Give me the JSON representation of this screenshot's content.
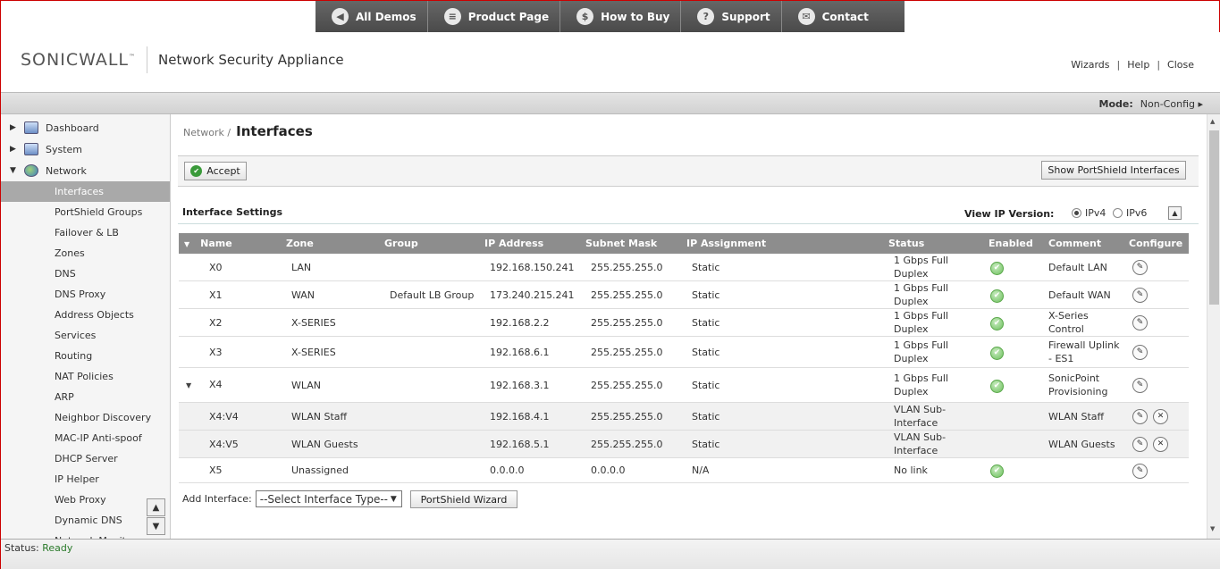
{
  "demo_nav": [
    {
      "label": "All Demos",
      "icon": "back-arrow-icon",
      "glyph": "◀"
    },
    {
      "label": "Product Page",
      "icon": "list-icon",
      "glyph": "≡"
    },
    {
      "label": "How to Buy",
      "icon": "dollar-icon",
      "glyph": "$"
    },
    {
      "label": "Support",
      "icon": "question-icon",
      "glyph": "?"
    },
    {
      "label": "Contact",
      "icon": "mail-icon",
      "glyph": "✉"
    }
  ],
  "header": {
    "logo_text": "SONICWALL",
    "logo_tm": "™",
    "product_title": "Network Security Appliance",
    "links": [
      "Wizards",
      "Help",
      "Close"
    ]
  },
  "modebar": {
    "mode_label": "Mode:",
    "mode_value": "Non-Config ▸"
  },
  "sidebar": {
    "top_items": [
      {
        "label": "Dashboard",
        "icon": "dashboard-icon"
      },
      {
        "label": "System",
        "icon": "monitor-icon"
      },
      {
        "label": "Network",
        "icon": "globe-icon"
      }
    ],
    "network_items": [
      "Interfaces",
      "PortShield Groups",
      "Failover & LB",
      "Zones",
      "DNS",
      "DNS Proxy",
      "Address Objects",
      "Services",
      "Routing",
      "NAT Policies",
      "ARP",
      "Neighbor Discovery",
      "MAC-IP Anti-spoof",
      "DHCP Server",
      "IP Helper",
      "Web Proxy",
      "Dynamic DNS",
      "Network Monitor"
    ],
    "active": "Interfaces"
  },
  "breadcrumb": {
    "parent": "Network /",
    "title": "Interfaces"
  },
  "toolbar": {
    "accept_label": "Accept",
    "portshield_label": "Show PortShield Interfaces"
  },
  "section": {
    "title": "Interface Settings",
    "ip_version_label": "View IP Version:",
    "ipv4": "IPv4",
    "ipv6": "IPv6",
    "selected": "IPv4"
  },
  "table": {
    "columns": [
      "Name",
      "Zone",
      "Group",
      "IP Address",
      "Subnet Mask",
      "IP Assignment",
      "Status",
      "Enabled",
      "Comment",
      "Configure"
    ],
    "rows": [
      {
        "name": "X0",
        "zone": "LAN",
        "group": "",
        "ip": "192.168.150.241",
        "mask": "255.255.255.0",
        "assign": "Static",
        "status": "1 Gbps Full Duplex",
        "enabled": true,
        "comment": "Default LAN",
        "sub": false,
        "expander": false,
        "delete": false
      },
      {
        "name": "X1",
        "zone": "WAN",
        "group": "Default LB Group",
        "ip": "173.240.215.241",
        "mask": "255.255.255.0",
        "assign": "Static",
        "status": "1 Gbps Full Duplex",
        "enabled": true,
        "comment": "Default WAN",
        "sub": false,
        "expander": false,
        "delete": false
      },
      {
        "name": "X2",
        "zone": "X-SERIES",
        "group": "",
        "ip": "192.168.2.2",
        "mask": "255.255.255.0",
        "assign": "Static",
        "status": "1 Gbps Full Duplex",
        "enabled": true,
        "comment": "X-Series Control",
        "sub": false,
        "expander": false,
        "delete": false
      },
      {
        "name": "X3",
        "zone": "X-SERIES",
        "group": "",
        "ip": "192.168.6.1",
        "mask": "255.255.255.0",
        "assign": "Static",
        "status": "1 Gbps Full Duplex",
        "enabled": true,
        "comment": "Firewall Uplink - ES1",
        "sub": false,
        "expander": false,
        "delete": false
      },
      {
        "name": "X4",
        "zone": "WLAN",
        "group": "",
        "ip": "192.168.3.1",
        "mask": "255.255.255.0",
        "assign": "Static",
        "status": "1 Gbps Full Duplex",
        "enabled": true,
        "comment": "SonicPoint Provisioning",
        "sub": false,
        "expander": true,
        "delete": false
      },
      {
        "name": "X4:V4",
        "zone": "WLAN Staff",
        "group": "",
        "ip": "192.168.4.1",
        "mask": "255.255.255.0",
        "assign": "Static",
        "status": "VLAN Sub-Interface",
        "enabled": false,
        "comment": "WLAN Staff",
        "sub": true,
        "expander": false,
        "delete": true
      },
      {
        "name": "X4:V5",
        "zone": "WLAN Guests",
        "group": "",
        "ip": "192.168.5.1",
        "mask": "255.255.255.0",
        "assign": "Static",
        "status": "VLAN Sub-Interface",
        "enabled": false,
        "comment": "WLAN Guests",
        "sub": true,
        "expander": false,
        "delete": true
      },
      {
        "name": "X5",
        "zone": "Unassigned",
        "group": "",
        "ip": "0.0.0.0",
        "mask": "0.0.0.0",
        "assign": "N/A",
        "status": "No link",
        "enabled": true,
        "comment": "",
        "sub": false,
        "expander": false,
        "delete": false
      }
    ]
  },
  "add_interface": {
    "label": "Add Interface:",
    "select_value": "--Select Interface Type--",
    "wizard_label": "PortShield Wizard"
  },
  "statusbar": {
    "label": "Status:",
    "value": "Ready"
  }
}
